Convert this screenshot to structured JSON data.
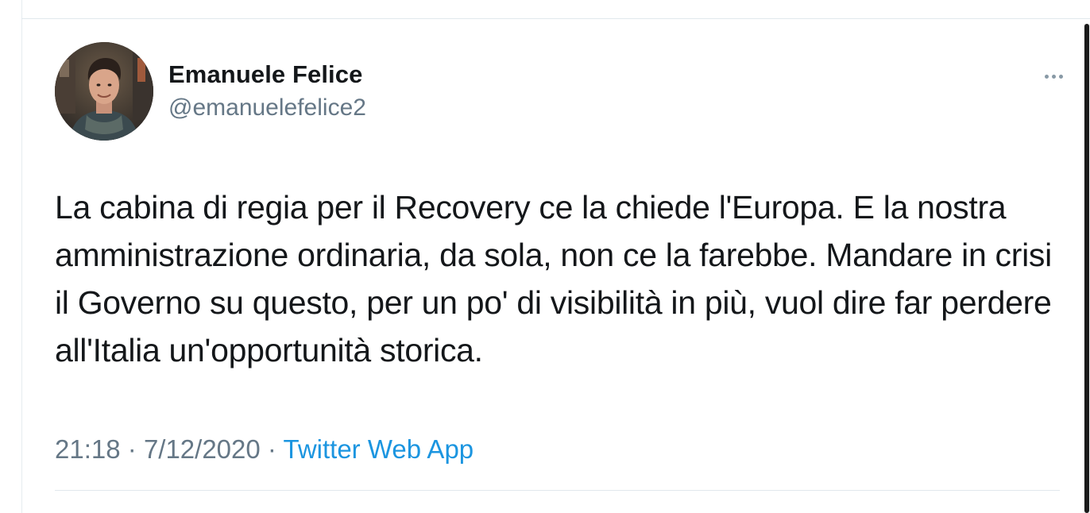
{
  "tweet": {
    "author": {
      "display_name": "Emanuele Felice",
      "handle": "@emanuelefelice2"
    },
    "text": "La cabina di regia per il Recovery ce la chiede l'Europa. E la nostra amministrazione ordinaria, da sola, non ce la farebbe. Mandare in crisi il Governo su questo, per un po' di visibilità in più, vuol dire far perdere all'Italia un'opportunità storica.",
    "time": "21:18",
    "separator": "·",
    "date": "7/12/2020",
    "source": "Twitter Web App"
  },
  "icons": {
    "more": "more-horizontal-icon",
    "avatar": "profile-photo"
  },
  "colors": {
    "text_primary": "#14171a",
    "text_secondary": "#657786",
    "link": "#1b95e0",
    "divider": "#e1e8ed"
  }
}
